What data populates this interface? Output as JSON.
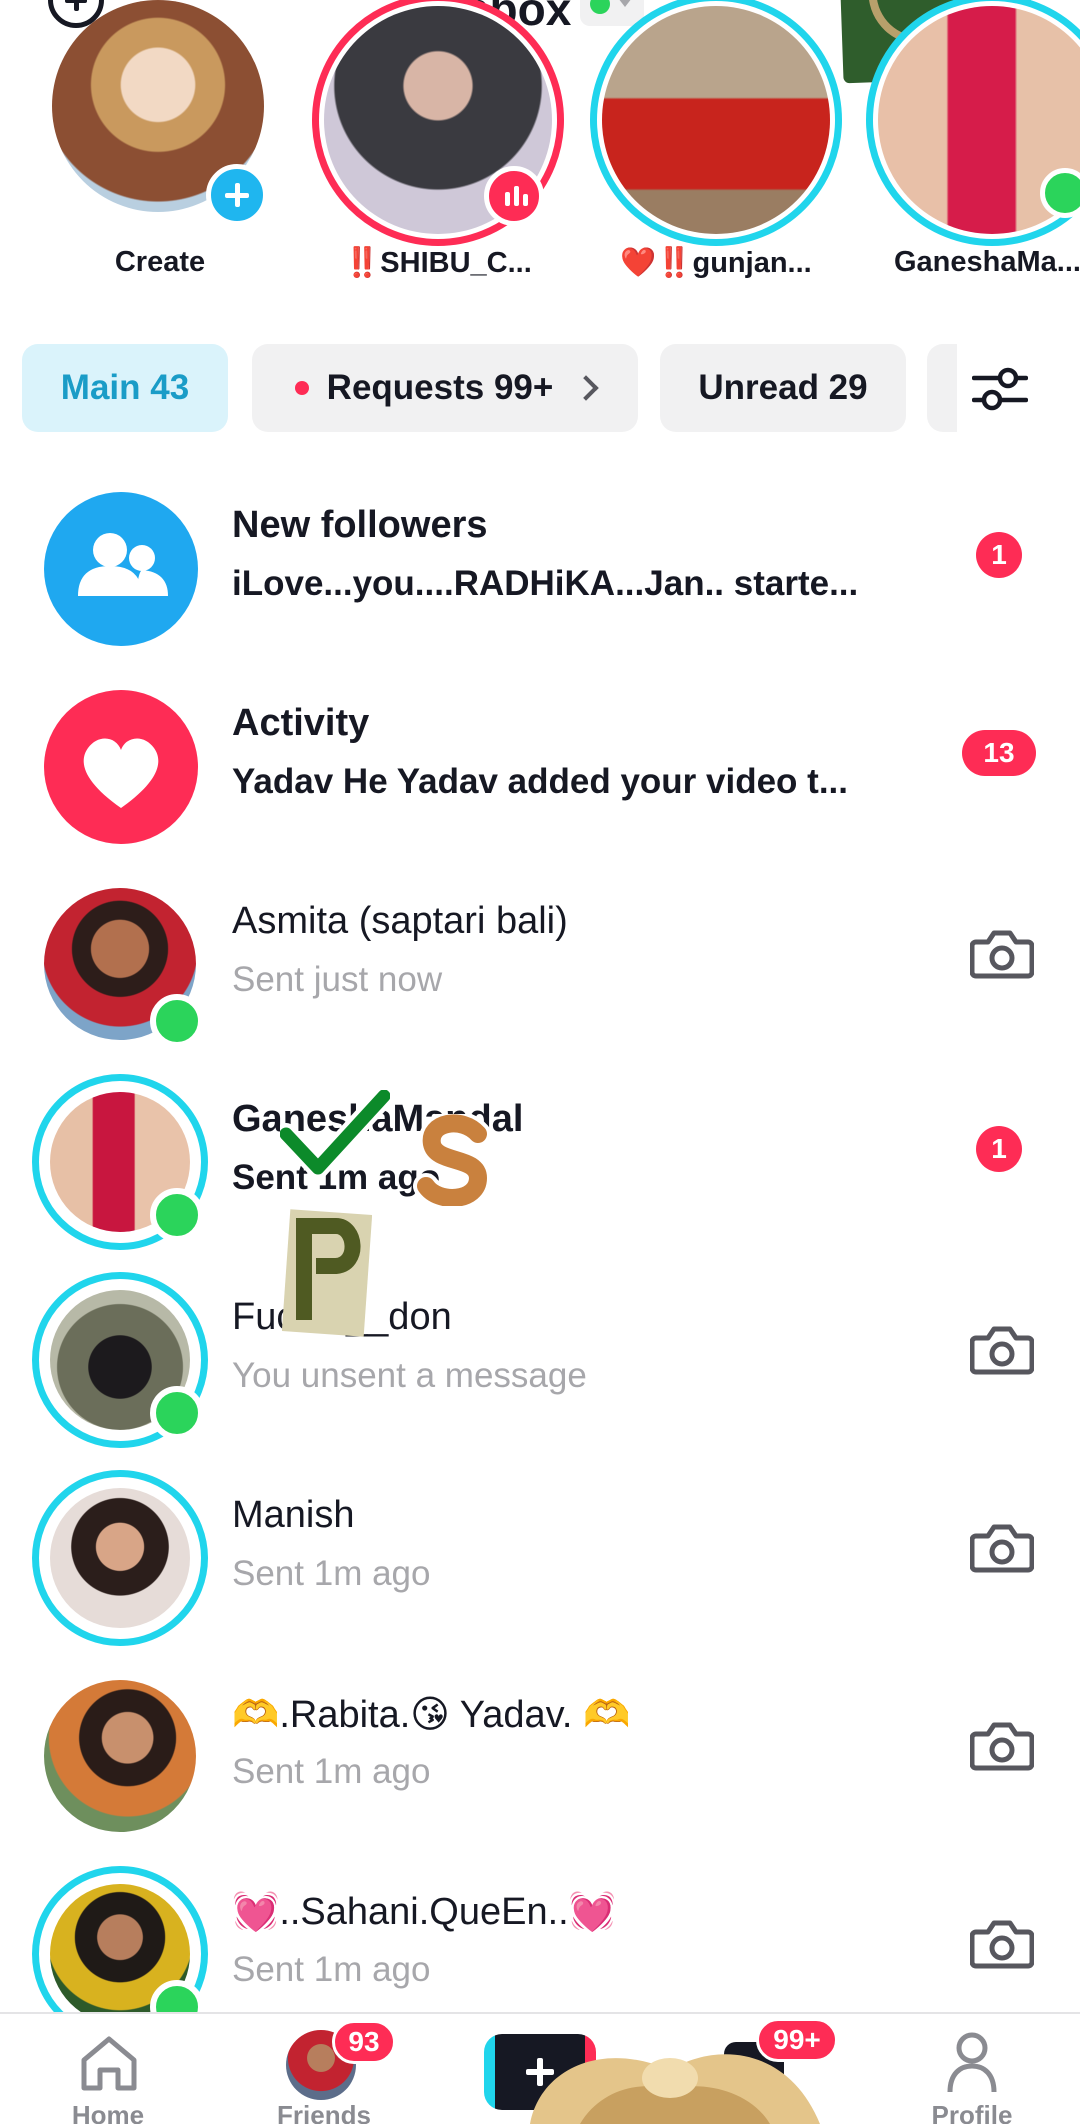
{
  "header": {
    "title": "Inbox",
    "status_dot_color": "#2bd45b"
  },
  "stories": [
    {
      "label": "Create",
      "badge": "plus"
    },
    {
      "label": "‼️SHIBU_C...",
      "badge": "live",
      "ring": "#fe2c55"
    },
    {
      "label": "❤️‼️gunjan...",
      "badge": "none",
      "ring": "#20d5ec"
    },
    {
      "label": "GaneshaMa...",
      "badge": "online",
      "ring": "#20d5ec"
    }
  ],
  "tabs": {
    "main": "Main 43",
    "requests": "Requests 99+",
    "unread": "Unread 29"
  },
  "conversations": [
    {
      "name": "New followers",
      "sub": "iLove...you....RADHiKA...Jan.. starte...",
      "badge": "1",
      "type": "followers"
    },
    {
      "name": "Activity",
      "sub": "Yadav He Yadav added your video t...",
      "badge": "13",
      "type": "activity"
    },
    {
      "name": "Asmita (saptari bali)",
      "sub": "Sent just now",
      "trailing": "camera-icon"
    },
    {
      "name": "GaneshaMandal",
      "sub": "Sent 1m ago",
      "badge": "1"
    },
    {
      "name": "Fucke __don",
      "sub": "You unsent a message",
      "trailing": "camera-icon"
    },
    {
      "name": "Manish",
      "sub": "Sent 1m ago",
      "trailing": "camera-icon"
    },
    {
      "name": "🫶.Rabita.😘 Yadav. 🫶",
      "sub": "Sent 1m ago",
      "trailing": "camera-icon"
    },
    {
      "name": "💓..Sahani.QueEn..💓",
      "sub": "Sent 1m ago",
      "trailing": "camera-icon"
    }
  ],
  "bottom_nav": {
    "home": "Home",
    "friends": "Friends",
    "friends_badge": "93",
    "inbox_badge": "99+",
    "profile": "Profile"
  },
  "colors": {
    "accent_pink": "#fe2c55",
    "accent_cyan": "#20d5ec",
    "followers_blue": "#1fa8f0",
    "online_green": "#2bd45b"
  }
}
